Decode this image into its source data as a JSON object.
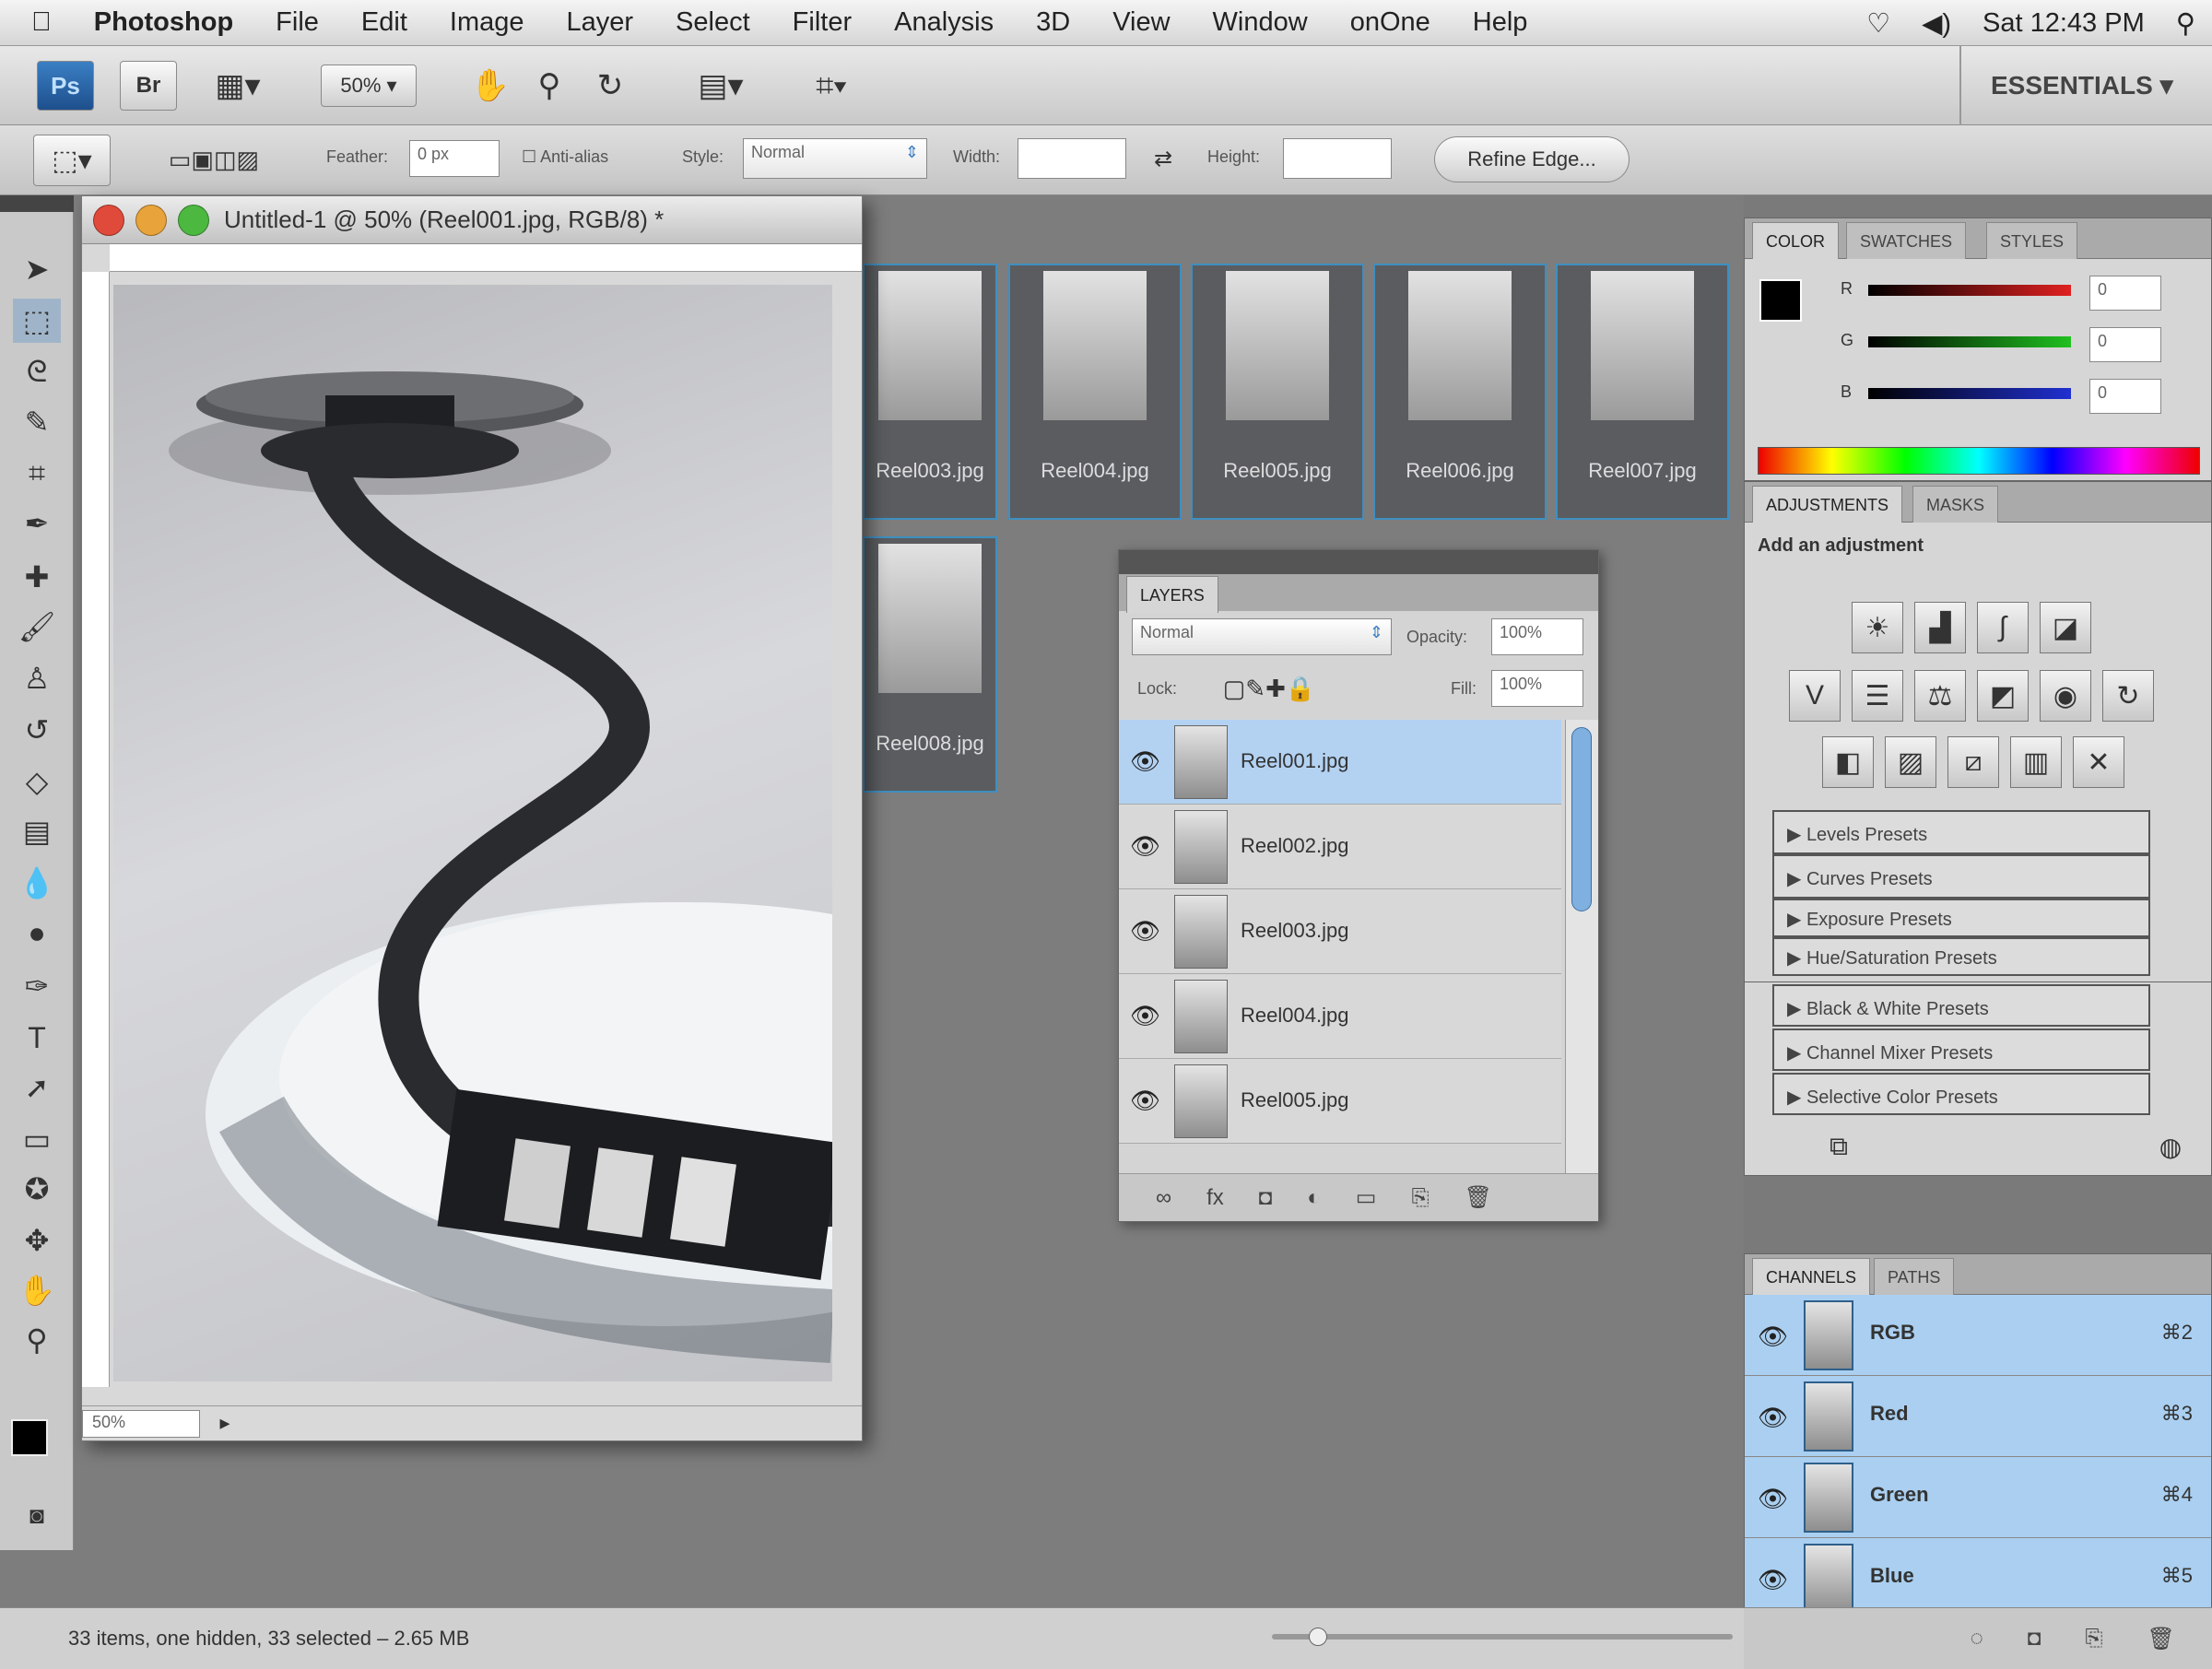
{
  "menubar": {
    "apple": "",
    "app_name": "Photoshop",
    "items": [
      "File",
      "Edit",
      "Image",
      "Layer",
      "Select",
      "Filter",
      "Analysis",
      "3D",
      "View",
      "Window",
      "onOne",
      "Help"
    ],
    "clock": "Sat 12:43 PM"
  },
  "appbar": {
    "ps_logo": "Ps",
    "bridge_logo": "Br",
    "zoom": "50%",
    "workspace": "ESSENTIALS"
  },
  "options": {
    "feather_label": "Feather:",
    "feather_value": "0 px",
    "antialias_label": "Anti-alias",
    "style_label": "Style:",
    "style_value": "Normal",
    "width_label": "Width:",
    "height_label": "Height:",
    "refine_label": "Refine Edge..."
  },
  "document": {
    "title": "Untitled-1 @ 50% (Reel001.jpg, RGB/8) *",
    "zoom": "50%"
  },
  "thumbnails": [
    "Reel003.jpg",
    "Reel004.jpg",
    "Reel005.jpg",
    "Reel006.jpg",
    "Reel007.jpg",
    "Reel008.jpg"
  ],
  "layers_panel": {
    "tab": "LAYERS",
    "blend_mode": "Normal",
    "opacity_label": "Opacity:",
    "opacity_value": "100%",
    "lock_label": "Lock:",
    "fill_label": "Fill:",
    "fill_value": "100%",
    "layers": [
      "Reel001.jpg",
      "Reel002.jpg",
      "Reel003.jpg",
      "Reel004.jpg",
      "Reel005.jpg"
    ]
  },
  "color_panel": {
    "tabs": [
      "COLOR",
      "SWATCHES",
      "STYLES"
    ],
    "channels": [
      {
        "label": "R",
        "value": "0",
        "color": "#e02020"
      },
      {
        "label": "G",
        "value": "0",
        "color": "#20c020"
      },
      {
        "label": "B",
        "value": "0",
        "color": "#2030d0"
      }
    ]
  },
  "adjustments_panel": {
    "tabs": [
      "ADJUSTMENTS",
      "MASKS"
    ],
    "heading": "Add an adjustment",
    "presets": [
      "Levels Presets",
      "Curves Presets",
      "Exposure Presets",
      "Hue/Saturation Presets",
      "Black & White Presets",
      "Channel Mixer Presets",
      "Selective Color Presets"
    ]
  },
  "channels_panel": {
    "tabs": [
      "CHANNELS",
      "PATHS"
    ],
    "channels": [
      {
        "name": "RGB",
        "key": "⌘2"
      },
      {
        "name": "Red",
        "key": "⌘3"
      },
      {
        "name": "Green",
        "key": "⌘4"
      },
      {
        "name": "Blue",
        "key": "⌘5"
      }
    ]
  },
  "statusbar": {
    "text": "33 items, one hidden, 33 selected – 2.65 MB"
  }
}
